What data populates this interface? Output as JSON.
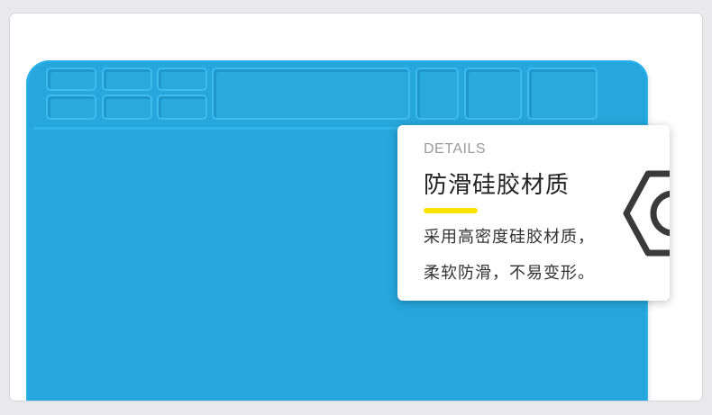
{
  "card": {
    "eyebrow": "DETAILS",
    "title": "防滑硅胶材质",
    "lines": [
      "采用高密度硅胶材质，",
      "柔软防滑，不易变形。"
    ]
  },
  "colors": {
    "mat": "#25a6dc",
    "accent": "#ffe100",
    "icon": "#3a3a3a"
  },
  "icons": {
    "card_corner": "hex-nut-icon"
  }
}
